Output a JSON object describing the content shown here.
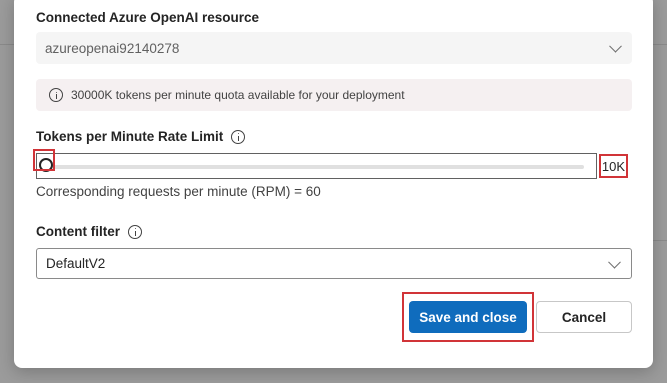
{
  "resource": {
    "label": "Connected Azure OpenAI resource",
    "selected": "azureopenai92140278"
  },
  "quota_info": {
    "icon": "info-icon",
    "text": "30000K tokens per minute quota available for your deployment"
  },
  "rate_limit": {
    "label": "Tokens per Minute Rate Limit",
    "info_icon": "info-icon",
    "value_display": "10K",
    "slider_position": 0.0,
    "rpm_text": "Corresponding requests per minute (RPM) = 60"
  },
  "content_filter": {
    "label": "Content filter",
    "info_icon": "info-icon",
    "selected": "DefaultV2"
  },
  "actions": {
    "save_label": "Save and close",
    "cancel_label": "Cancel"
  },
  "colors": {
    "primary": "#0f6cbd",
    "highlight": "#d13438"
  }
}
